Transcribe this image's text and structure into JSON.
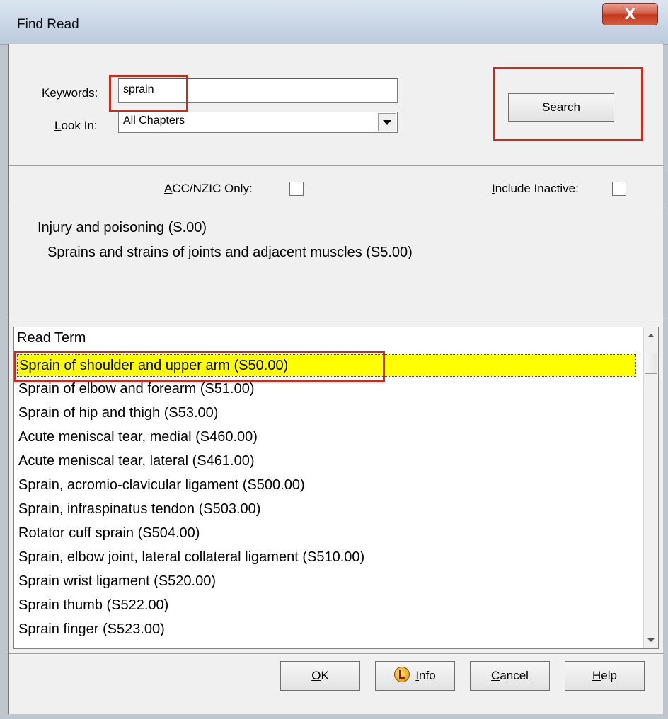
{
  "window": {
    "title": "Find Read",
    "close_label": "X"
  },
  "search": {
    "keywords_label": "Keywords:",
    "keywords_value": "sprain",
    "lookin_label": "Look In:",
    "lookin_value": "All Chapters",
    "search_button": "Search"
  },
  "filters": {
    "acc_label": "ACC/NZIC Only:",
    "acc_checked": false,
    "inactive_label": "Include Inactive:",
    "inactive_checked": false
  },
  "path": {
    "level1": "Injury and poisoning (S.00)",
    "level2": "Sprains and strains of joints and adjacent muscles (S5.00)"
  },
  "list": {
    "header": "Read Term",
    "items": [
      "Sprain of shoulder and upper arm (S50.00)",
      "Sprain of elbow and forearm (S51.00)",
      "Sprain of hip and thigh (S53.00)",
      "Acute meniscal tear, medial (S460.00)",
      "Acute meniscal tear, lateral (S461.00)",
      "Sprain, acromio-clavicular ligament (S500.00)",
      "Sprain, infraspinatus tendon (S503.00)",
      "Rotator cuff sprain (S504.00)",
      "Sprain, elbow joint, lateral collateral ligament (S510.00)",
      "Sprain wrist ligament (S520.00)",
      "Sprain thumb (S522.00)",
      "Sprain finger (S523.00)"
    ],
    "selected_index": 0
  },
  "buttons": {
    "ok": "OK",
    "info": "Info",
    "cancel": "Cancel",
    "help": "Help"
  },
  "colors": {
    "highlight_box": "#cc2a1a",
    "selected_row": "#ffff00"
  }
}
